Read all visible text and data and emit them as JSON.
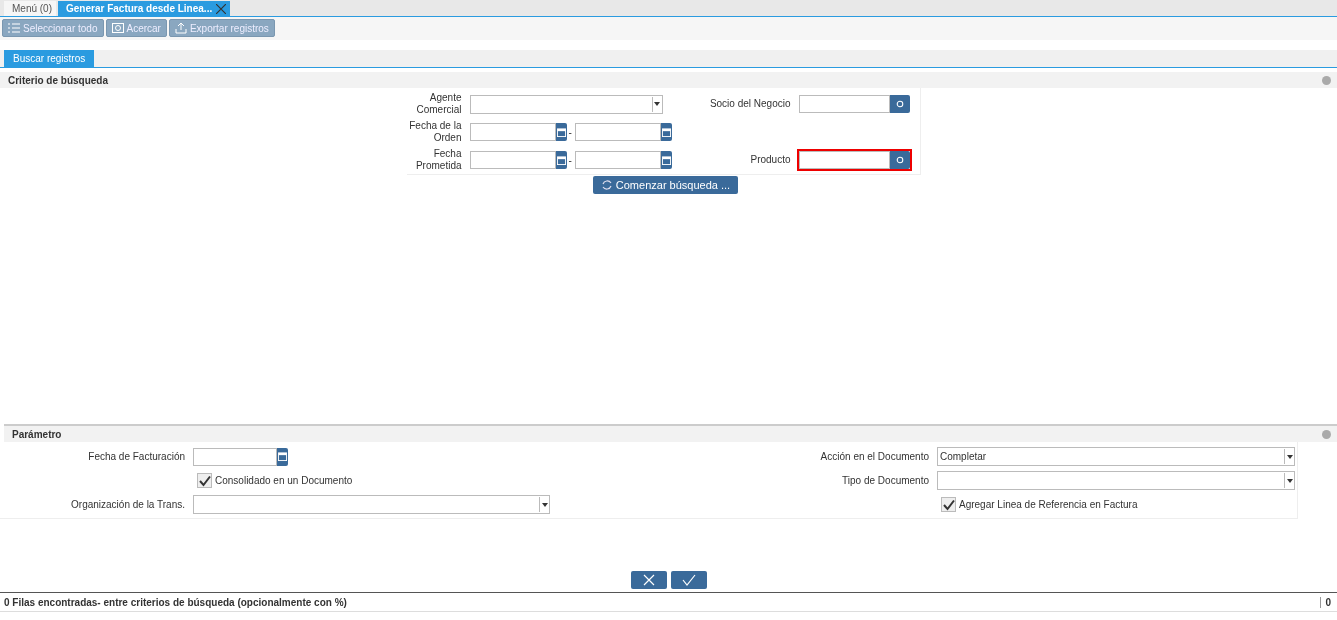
{
  "window_tabs": [
    {
      "label": "Menú (0)",
      "selected": false,
      "closable": false
    },
    {
      "label": "Generar Factura desde Linea...",
      "selected": true,
      "closable": true
    }
  ],
  "toolbar": [
    {
      "label": "Seleccionar todo",
      "kind": "list"
    },
    {
      "label": "Acercar",
      "kind": "zoom"
    },
    {
      "label": "Exportar registros",
      "kind": "export"
    }
  ],
  "search_tabs": [
    {
      "label": "Buscar registros",
      "selected": true
    }
  ],
  "search": {
    "title": "Criterio de búsqueda",
    "rows": [
      {
        "left": {
          "label": "Agente Comercial",
          "kind": "combo"
        },
        "right": {
          "label": "Socio del Negocio",
          "kind": "lookup",
          "invalid": false
        }
      },
      {
        "left": {
          "label": "Fecha de la Orden",
          "kind": "date_range",
          "separator": "-"
        }
      },
      {
        "left": {
          "label": "Fecha Prometida",
          "kind": "date_range",
          "separator": "-"
        },
        "right": {
          "label": "Producto",
          "kind": "lookup",
          "invalid": true
        }
      }
    ],
    "button": "Comenzar búsqueda ..."
  },
  "params": {
    "title": "Parámetro",
    "rows": [
      {
        "left": {
          "label": "Fecha de Facturación",
          "kind": "date"
        },
        "right": {
          "label": "Acción en el Documento",
          "kind": "combo",
          "value": "Completar"
        }
      },
      {
        "left": {
          "label": "Consolidado en un Documento",
          "kind": "checkbox",
          "checked": true
        },
        "right": {
          "label": "Tipo de Documento",
          "kind": "combo"
        }
      },
      {
        "left": {
          "label": "Organización de la Trans.",
          "kind": "combo"
        },
        "right": {
          "label": "Agregar Linea de Referencia en Factura",
          "kind": "checkbox",
          "checked": true
        }
      }
    ]
  },
  "status_bar": {
    "message": "0 Filas encontradas- entre criterios de búsqueda (opcionalmente con %)",
    "count": "0"
  }
}
